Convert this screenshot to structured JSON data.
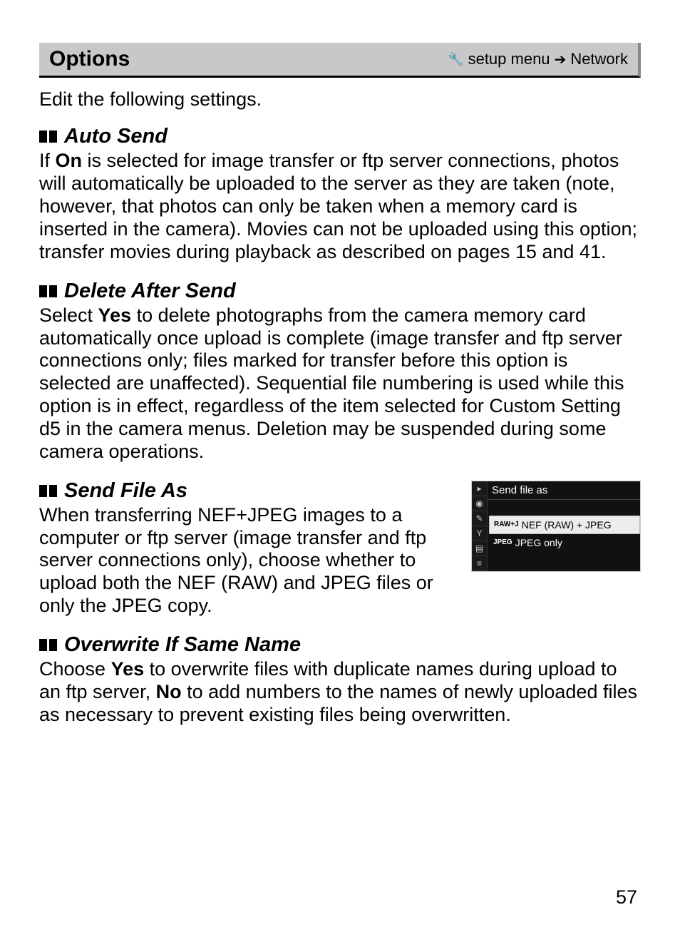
{
  "header": {
    "title": "Options",
    "breadcrumb_setup": "setup menu",
    "breadcrumb_network": "Network"
  },
  "intro": "Edit the following settings.",
  "sections": {
    "auto_send": {
      "title": "Auto Send",
      "body_pre": "If ",
      "body_bold1": "On",
      "body_post": " is selected for image transfer or ftp server connections, photos will automatically be uploaded to the server as they are taken (note, however, that photos can only be taken when a memory card is inserted in the camera). Movies can not be uploaded using this option; transfer movies during playback as described on pages 15 and 41."
    },
    "delete_after_send": {
      "title": " Delete After Send",
      "body_pre": "Select ",
      "body_bold1": "Yes",
      "body_post": " to delete photographs from the camera memory card automatically once upload is complete (image transfer and ftp server connections only; files marked for transfer before this option is selected are unaffected). Sequential file numbering is used while this option is in effect, regardless of the item selected for Custom Setting d5 in the camera menus. Deletion may be suspended during some camera operations."
    },
    "send_file_as": {
      "title": "Send File As",
      "body": "When transferring NEF+JPEG images to a computer or ftp server (image transfer and ftp server connections only), choose whether to upload both the NEF (RAW) and JPEG files or only the JPEG copy."
    },
    "overwrite": {
      "title": "Overwrite If Same Name",
      "body_pre": "Choose ",
      "body_bold1": "Yes",
      "body_mid": " to overwrite files with duplicate names during upload to an ftp server, ",
      "body_bold2": "No",
      "body_post": " to add numbers to the names of newly uploaded files as necessary to prevent existing files being overwritten."
    }
  },
  "screenshot": {
    "title": "Send file as",
    "option1_badge": "RAW+J",
    "option1_label": "NEF (RAW) + JPEG",
    "option2_badge": "JPEG",
    "option2_label": "JPEG only"
  },
  "page_number": "57"
}
